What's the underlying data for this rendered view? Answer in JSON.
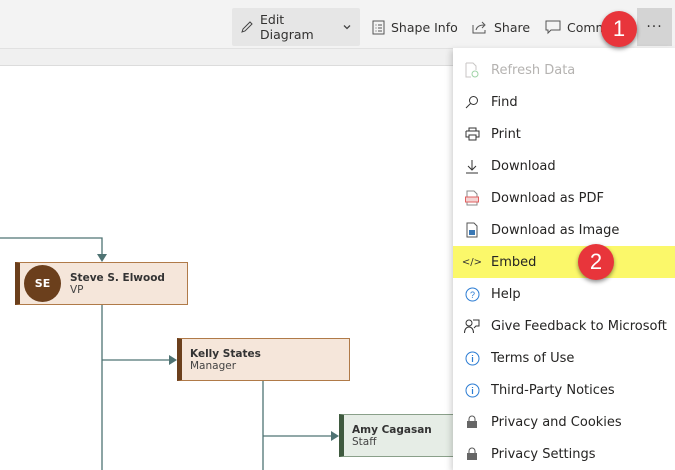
{
  "toolbar": {
    "edit_diagram": "Edit Diagram",
    "shape_info": "Shape Info",
    "share": "Share",
    "comments": "Comm",
    "more": "···"
  },
  "callouts": {
    "one": "1",
    "two": "2"
  },
  "menu": {
    "items": [
      {
        "label": "Refresh Data",
        "icon": "refresh-data-icon",
        "disabled": true
      },
      {
        "label": "Find",
        "icon": "search-icon"
      },
      {
        "label": "Print",
        "icon": "printer-icon"
      },
      {
        "label": "Download",
        "icon": "download-icon"
      },
      {
        "label": "Download as PDF",
        "icon": "pdf-icon"
      },
      {
        "label": "Download as Image",
        "icon": "image-icon"
      },
      {
        "label": "Embed",
        "icon": "code-icon",
        "highlighted": true
      },
      {
        "label": "Help",
        "icon": "help-icon"
      },
      {
        "label": "Give Feedback to Microsoft",
        "icon": "feedback-icon"
      },
      {
        "label": "Terms of Use",
        "icon": "info-icon"
      },
      {
        "label": "Third-Party Notices",
        "icon": "info-icon"
      },
      {
        "label": "Privacy and Cookies",
        "icon": "lock-icon"
      },
      {
        "label": "Privacy Settings",
        "icon": "lock-icon"
      }
    ]
  },
  "diagram": {
    "nodes": [
      {
        "name": "Steve S. Elwood",
        "title": "VP",
        "initials": "SE"
      },
      {
        "name": "Kelly States",
        "title": "Manager"
      },
      {
        "name": "Amy Cagasan",
        "title": "Staff"
      }
    ]
  },
  "colors": {
    "highlight": "#fbf86a",
    "callout": "#e8353b",
    "manager_fill": "#f5e6da",
    "staff_fill": "#e6ede6",
    "connector": "#4f7373",
    "accent_brown": "#6b3f1c"
  }
}
